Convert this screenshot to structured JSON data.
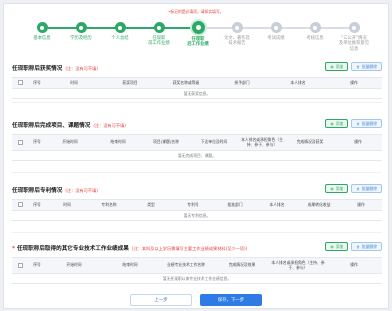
{
  "hint": "*标记的是必填项，请如实填写。",
  "steps": [
    {
      "label": "基本信息",
      "state": "done"
    },
    {
      "label": "学历及经历",
      "state": "done"
    },
    {
      "label": "个人总结",
      "state": "done"
    },
    {
      "label": "任现职\n前工作业绩",
      "state": "done"
    },
    {
      "label": "任现职\n后工作业绩",
      "state": "current"
    },
    {
      "label": "论文、著作及\n技术报告",
      "state": "todo"
    },
    {
      "label": "考试成绩",
      "state": "todo"
    },
    {
      "label": "考核信息",
      "state": "todo"
    },
    {
      "label": "\"三公开\"情况\n及单位推荐意见\n信息",
      "state": "todo"
    }
  ],
  "buttons": {
    "add": "添加",
    "delete": "批量删除"
  },
  "sections": [
    {
      "title": "任现职称后获奖情况",
      "note": "(注：没有可不填)",
      "required": false,
      "columns": [
        "选择",
        "序号",
        "时间",
        "获奖项目",
        "获奖名称或等级",
        "授予部门",
        "本人排名",
        "操作"
      ],
      "empty": "暂无获奖信息。"
    },
    {
      "title": "任现职称后完成项目、课题情况",
      "note": "(注：没有可不填)",
      "required": false,
      "columns": [
        "选择",
        "序号",
        "开始时间",
        "结束时间",
        "项目(课题)名称",
        "下达单位及时间",
        "本人排名或承担角色（主持、参于、参与）",
        "完成情况及获奖",
        "操作"
      ],
      "empty": "暂无完成项目、课题。"
    },
    {
      "title": "任现职称后专利情况",
      "note": "(注：没有可不填)",
      "required": false,
      "columns": [
        "选择",
        "序号",
        "时间",
        "专利名称",
        "类型",
        "专利号",
        "批准部门",
        "本人排名",
        "成果转化收益",
        "操作"
      ],
      "empty": "暂无专利信息。"
    },
    {
      "title": "任现职称后取得的其它专业技术工作业绩成果",
      "note": "(注：本科及以上学历需填写主要工作业绩成果材料(至少一项))",
      "required": true,
      "columns": [
        "选择",
        "序号",
        "开始时间",
        "结束时间",
        "业绩专业技术工作名称",
        "完成情况及效果",
        "本人排名或承担角色（主持、参于、参与）",
        "操作"
      ],
      "empty": "暂无任现职以来专业技术工作业绩信息。"
    }
  ],
  "footer": {
    "prev": "上一步",
    "next": "保存，下一步"
  },
  "colors": {
    "accent": "#2ea866",
    "primary": "#2f7be6",
    "danger": "#e0413a"
  }
}
